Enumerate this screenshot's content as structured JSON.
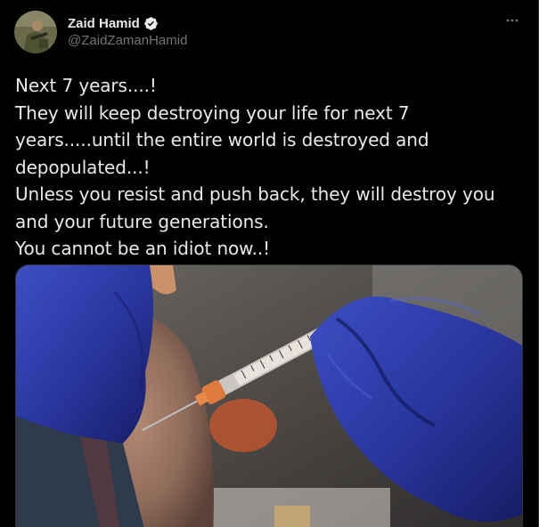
{
  "author": {
    "display_name": "Zaid Hamid",
    "handle": "@ZaidZamanHamid",
    "verified": true
  },
  "tweet": {
    "text": "Next 7 years....!\nThey will keep destroying your life for next 7 years.....until the entire world is destroyed and depopulated...!\nUnless you resist and push back, they will destroy you and your future generations.\nYou cannot be an idiot now..!"
  },
  "icons": {
    "verified": "verified-badge-icon",
    "more": "more-options-icon"
  },
  "colors": {
    "background": "#000000",
    "text": "#e7e9ea",
    "secondary_text": "#71767b",
    "verified_badge": "#e7e9ea",
    "glove": "#2b3a9e"
  }
}
